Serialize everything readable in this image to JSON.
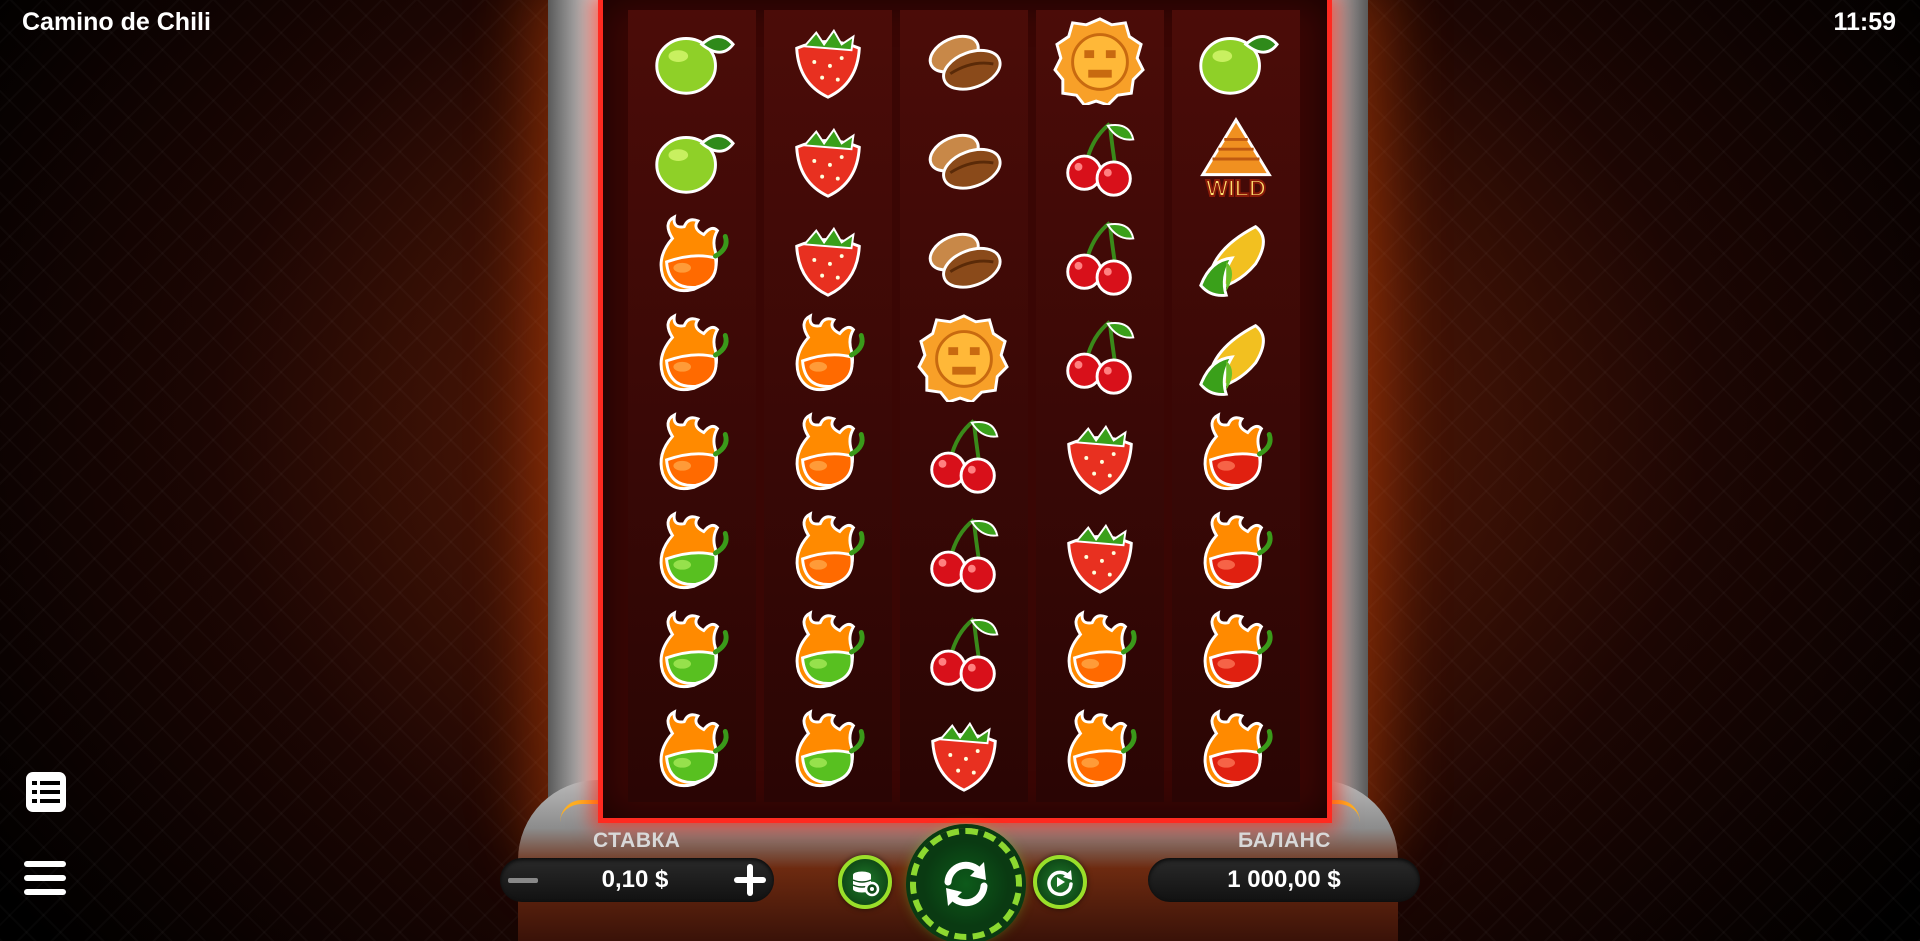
{
  "app": {
    "title": "Camino de Chili",
    "clock": "11:59"
  },
  "controls": {
    "bet_label": "СТАВКА",
    "bet_value": "0,10 $",
    "balance_label": "БАЛАНС",
    "balance_value": "1 000,00 $"
  },
  "colors": {
    "accent_green": "#8cd830",
    "frame_red": "#ff2a20",
    "cabinet_orange": "#ff9a12"
  },
  "reels": [
    [
      "lime",
      "lime",
      "chili-orange",
      "chili-orange",
      "chili-orange",
      "chili-green",
      "chili-green",
      "chili-green"
    ],
    [
      "strawberry",
      "strawberry",
      "strawberry",
      "chili-orange",
      "chili-orange",
      "chili-orange",
      "chili-green",
      "chili-green"
    ],
    [
      "cocoa",
      "cocoa",
      "cocoa",
      "aztec-scatter",
      "cherry",
      "cherry",
      "cherry",
      "strawberry"
    ],
    [
      "aztec-scatter",
      "cherry",
      "cherry",
      "cherry",
      "strawberry",
      "strawberry",
      "chili-orange",
      "chili-orange"
    ],
    [
      "lime",
      "wild-pyramid",
      "corn",
      "corn",
      "chili-red",
      "chili-red",
      "chili-red",
      "chili-red"
    ]
  ],
  "wild_text": "WILD"
}
